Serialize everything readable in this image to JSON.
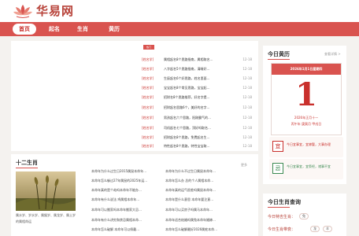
{
  "site": {
    "name": "华易网"
  },
  "nav": {
    "items": [
      "首页",
      "起名",
      "生肖",
      "黄历"
    ]
  },
  "news": {
    "tag": "热门",
    "rows": [
      {
        "cat": "[姓名学]",
        "title": "属相起名8个思路指南，属相取名…",
        "time": "12-18"
      },
      {
        "cat": "[姓名学]",
        "title": "八字起名5个思路指南，清晰好…",
        "time": "12-18"
      },
      {
        "cat": "[姓名学]",
        "title": "生辰起名6个好思路，姓名里面…",
        "time": "12-18"
      },
      {
        "cat": "[姓名学]",
        "title": "宝宝起名8个常见思路，宝宝起…",
        "time": "12-18"
      },
      {
        "cat": "[姓名学]",
        "title": "招财名8个思路推荐，好名字提…",
        "time": "12-18"
      },
      {
        "cat": "[姓名学]",
        "title": "招财起名思路6个，美好的名字…",
        "time": "12-18"
      },
      {
        "cat": "[姓名学]",
        "title": "男孩起名六个思路，阳刚霸气的…",
        "time": "12-18"
      },
      {
        "cat": "[姓名学]",
        "title": "司机起名七个思路，顶好吗取名…",
        "time": "12-18"
      },
      {
        "cat": "[姓名学]",
        "title": "招财起名8个思路，免费起名生…",
        "time": "12-18"
      },
      {
        "cat": "[姓名学]",
        "title": "特性起名8个思路，特性宝宝取…",
        "time": "12-18"
      }
    ]
  },
  "zodiac": {
    "title": "十二生肖",
    "more": "更多",
    "caption": "属水岁、岁水岁、属猴岁、属龙岁、属土岁的属相命运",
    "links_col1": [
      "本命年为什么过生日2015属鼠本命年…",
      "本命年怎么躲过27年属鼠的2025年运…",
      "本命年真的是个劫吗本命年不能办…",
      "本命年有什么说法 鸡属相本命年…",
      "本命年可以搬家吗本命年搬家大忌…",
      "本命年有什么讲究和禁忌属相本命…",
      "本命年怎么破解 本命年可以佩戴…"
    ],
    "links_col2": [
      "本命年为什么不过生日属鼠本命年…",
      "本命年怎么办 总的个人属相本命…",
      "本命年真的运气很差吗属鼠本命年…",
      "本命年是什么意思 本命年要注意…",
      "本命年可以买房子吗属马本命年…",
      "本命年适合结婚吗属兔本命年婚嫁…",
      "本命年怎么破解最好2026属蛇本命…"
    ]
  },
  "almanac": {
    "title": "今日黄历",
    "more": "查看详情 >",
    "date_header": "2026年1月1日星期四",
    "day": "1",
    "lunar": "2026年正月十一",
    "ganzhi": "丙午年 庚寅月 甲戌日",
    "yi_label": "宜",
    "yi_text": "今日宜事宜，宜嫁娶，大事办理",
    "ji_label": "忌",
    "ji_text": "今日宜事宜，宜祭祀，诸事不宜"
  },
  "zodiac_query": {
    "title": "今日生肖查询",
    "row1_label": "今日特吉生肖：",
    "row1_chips": [
      "兔"
    ],
    "row2_label": "今日生肖带衰：",
    "row2_chips": [
      "龙",
      "羊"
    ]
  },
  "colors": {
    "brand": "#d9534f",
    "accent": "#c9302c",
    "yi": "#c9302c",
    "ji": "#3c8a52"
  }
}
